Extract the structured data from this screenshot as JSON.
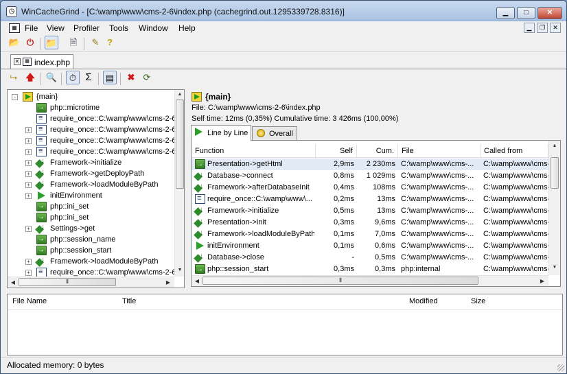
{
  "window": {
    "title": "WinCacheGrind - [C:\\wamp\\www\\cms-2-6\\index.php (cachegrind.out.1295339728.8316)]",
    "min_symbol": "▁",
    "max_symbol": "□",
    "close_symbol": "✕"
  },
  "menu": {
    "items": [
      "File",
      "View",
      "Profiler",
      "Tools",
      "Window",
      "Help"
    ]
  },
  "toolbar1": {
    "icons": [
      "open-folder-icon",
      "stop-profile-icon",
      "folder-view-icon",
      "properties-icon",
      "bookmark-icon",
      "help-icon"
    ]
  },
  "doc_tab": {
    "label": "index.php"
  },
  "toolbar2": {
    "icons": [
      "up-folder-icon",
      "red-up-arrow-icon",
      "find-icon",
      "time-mode-icon",
      "sigma-icon",
      "ms-units-icon",
      "red-x-icon",
      "refresh-icon"
    ],
    "sigma": "Σ"
  },
  "tree": {
    "items": [
      {
        "label": "{main}",
        "icon": "main",
        "depth": 0,
        "expander": "-"
      },
      {
        "label": "php::microtime",
        "icon": "phpfn",
        "depth": 1,
        "expander": ""
      },
      {
        "label": "require_once::C:\\wamp\\www\\cms-2-6",
        "icon": "file",
        "depth": 1,
        "expander": ""
      },
      {
        "label": "require_once::C:\\wamp\\www\\cms-2-6",
        "icon": "file",
        "depth": 1,
        "expander": "+"
      },
      {
        "label": "require_once::C:\\wamp\\www\\cms-2-6",
        "icon": "file",
        "depth": 1,
        "expander": "+"
      },
      {
        "label": "require_once::C:\\wamp\\www\\cms-2-6",
        "icon": "file",
        "depth": 1,
        "expander": "+"
      },
      {
        "label": "Framework->initialize",
        "icon": "method",
        "depth": 1,
        "expander": "+"
      },
      {
        "label": "Framework->getDeployPath",
        "icon": "method",
        "depth": 1,
        "expander": "+"
      },
      {
        "label": "Framework->loadModuleByPath",
        "icon": "method",
        "depth": 1,
        "expander": "+"
      },
      {
        "label": "initEnvironment",
        "icon": "play",
        "depth": 1,
        "expander": "+"
      },
      {
        "label": "php::ini_set",
        "icon": "phpfn",
        "depth": 1,
        "expander": ""
      },
      {
        "label": "php::ini_set",
        "icon": "phpfn",
        "depth": 1,
        "expander": ""
      },
      {
        "label": "Settings->get",
        "icon": "method",
        "depth": 1,
        "expander": "+"
      },
      {
        "label": "php::session_name",
        "icon": "phpfn",
        "depth": 1,
        "expander": ""
      },
      {
        "label": "php::session_start",
        "icon": "phpfn",
        "depth": 1,
        "expander": ""
      },
      {
        "label": "Framework->loadModuleByPath",
        "icon": "method",
        "depth": 1,
        "expander": "+"
      },
      {
        "label": "require_once::C:\\wamp\\www\\cms-2-6",
        "icon": "file",
        "depth": 1,
        "expander": "+"
      }
    ]
  },
  "details": {
    "function_name": "{main}",
    "file_line": "File: C:\\wamp\\www\\cms-2-6\\index.php",
    "times_line": "Self time: 12ms (0,35%)   Cumulative time: 3 426ms (100,00%)",
    "tabs": [
      {
        "label": "Line by Line",
        "active": true
      },
      {
        "label": "Overall",
        "active": false
      }
    ],
    "columns": [
      "Function",
      "Self",
      "Cum.",
      "File",
      "Called from"
    ],
    "rows": [
      {
        "function": "Presentation->getHtml",
        "icon": "ref",
        "self": "2,9ms",
        "cum": "2 230ms",
        "file": "C:\\wamp\\www\\cms-...",
        "called_from": "C:\\wamp\\www\\cms-",
        "selected": true
      },
      {
        "function": "Database->connect",
        "icon": "method",
        "self": "0,8ms",
        "cum": "1 029ms",
        "file": "C:\\wamp\\www\\cms-...",
        "called_from": "C:\\wamp\\www\\cms-"
      },
      {
        "function": "Framework->afterDatabaseInit",
        "icon": "method",
        "self": "0,4ms",
        "cum": "108ms",
        "file": "C:\\wamp\\www\\cms-...",
        "called_from": "C:\\wamp\\www\\cms-"
      },
      {
        "function": "require_once::C:\\wamp\\www\\...",
        "icon": "file",
        "self": "0,2ms",
        "cum": "13ms",
        "file": "C:\\wamp\\www\\cms-...",
        "called_from": "C:\\wamp\\www\\cms-"
      },
      {
        "function": "Framework->initialize",
        "icon": "method",
        "self": "0,5ms",
        "cum": "13ms",
        "file": "C:\\wamp\\www\\cms-...",
        "called_from": "C:\\wamp\\www\\cms-"
      },
      {
        "function": "Presentation->init",
        "icon": "method",
        "self": "0,3ms",
        "cum": "9,6ms",
        "file": "C:\\wamp\\www\\cms-...",
        "called_from": "C:\\wamp\\www\\cms-"
      },
      {
        "function": "Framework->loadModuleByPath",
        "icon": "method",
        "self": "0,1ms",
        "cum": "7,0ms",
        "file": "C:\\wamp\\www\\cms-...",
        "called_from": "C:\\wamp\\www\\cms-"
      },
      {
        "function": "initEnvironment",
        "icon": "play",
        "self": "0,1ms",
        "cum": "0,6ms",
        "file": "C:\\wamp\\www\\cms-...",
        "called_from": "C:\\wamp\\www\\cms-"
      },
      {
        "function": "Database->close",
        "icon": "method",
        "self": "-",
        "cum": "0,5ms",
        "file": "C:\\wamp\\www\\cms-...",
        "called_from": "C:\\wamp\\www\\cms-"
      },
      {
        "function": "php::session_start",
        "icon": "phpfn",
        "self": "0,3ms",
        "cum": "0,3ms",
        "file": "php:internal",
        "called_from": "C:\\wamp\\www\\cms-"
      }
    ]
  },
  "file_list": {
    "columns": [
      "File Name",
      "Title",
      "Modified",
      "Size"
    ]
  },
  "status": {
    "text": "Allocated memory: 0 bytes"
  },
  "scroll": {
    "up": "▲",
    "down": "▼",
    "left": "◀",
    "right": "▶",
    "grip": "⦀"
  },
  "colors": {
    "selection": "#e2eaf6",
    "titlebar": "#b9cfea"
  }
}
